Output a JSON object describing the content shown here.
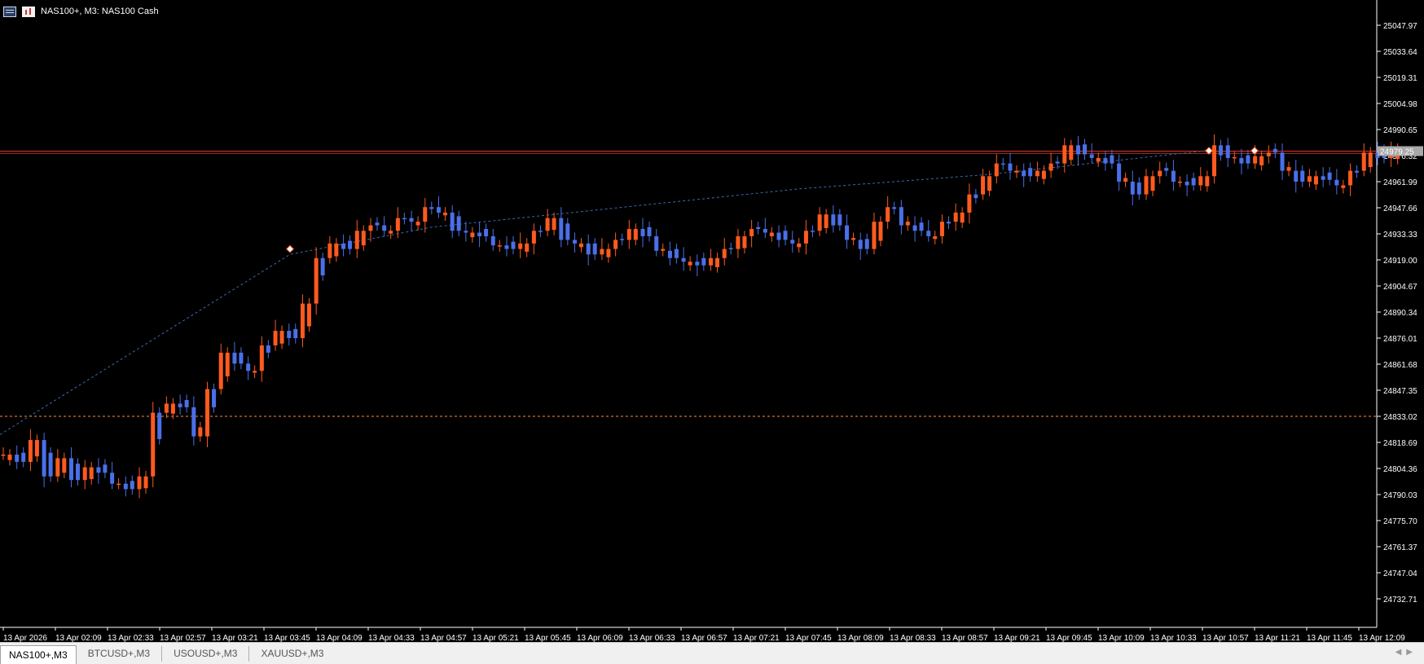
{
  "window": {
    "title": "NAS100+, M3:  NAS100 Cash"
  },
  "icons": [
    "menu-icon",
    "chart-type-icon"
  ],
  "colors": {
    "background": "#000000",
    "bull_candle": "#ff5a1f",
    "bear_candle": "#4a6fe8",
    "grid_axis": "#ffffff",
    "price_line": "#e0382a",
    "bid_label_bg": "#a9a9a9",
    "level_line": "#ff8c3a",
    "trend_line": "#3a6bb0"
  },
  "chart": {
    "current_price_label": "24979.25",
    "y_ticks": [
      "25047.97",
      "25033.64",
      "25019.31",
      "25004.98",
      "24990.65",
      "24976.32",
      "24961.99",
      "24947.66",
      "24933.33",
      "24919.00",
      "24904.67",
      "24890.34",
      "24876.01",
      "24861.68",
      "24847.35",
      "24833.02",
      "24818.69",
      "24804.36",
      "24790.03",
      "24775.70",
      "24761.37",
      "24747.04",
      "24732.71"
    ],
    "x_ticks": [
      "13 Apr 2026",
      "13 Apr 02:09",
      "13 Apr 02:33",
      "13 Apr 02:57",
      "13 Apr 03:21",
      "13 Apr 03:45",
      "13 Apr 04:09",
      "13 Apr 04:33",
      "13 Apr 04:57",
      "13 Apr 05:21",
      "13 Apr 05:45",
      "13 Apr 06:09",
      "13 Apr 06:33",
      "13 Apr 06:57",
      "13 Apr 07:21",
      "13 Apr 07:45",
      "13 Apr 08:09",
      "13 Apr 08:33",
      "13 Apr 08:57",
      "13 Apr 09:21",
      "13 Apr 09:45",
      "13 Apr 10:09",
      "13 Apr 10:33",
      "13 Apr 10:57",
      "13 Apr 11:21",
      "13 Apr 11:45",
      "13 Apr 12:09"
    ],
    "horizontal_levels": [
      24978.8,
      24833.0
    ],
    "close_path": [
      24812,
      24808,
      24820,
      24800,
      24810,
      24798,
      24805,
      24802,
      24796,
      24793,
      24800,
      24835,
      24840,
      24838,
      24822,
      24848,
      24868,
      24862,
      24858,
      24872,
      24880,
      24876,
      24895,
      24920,
      24928,
      24925,
      24935,
      24938,
      24935,
      24942,
      24940,
      24948,
      24945,
      24935,
      24934,
      24932,
      24927,
      24925,
      24928,
      24935,
      24942,
      24930,
      24928,
      24922,
      24925,
      24930,
      24936,
      24932,
      24924,
      24920,
      24918,
      24916,
      24920,
      24925,
      24932,
      24936,
      24934,
      24930,
      24928,
      24935,
      24944,
      24938,
      24930,
      24925,
      24940,
      24948,
      24938,
      24935,
      24932,
      24940,
      24945,
      24955,
      24965,
      24972,
      24968,
      24965,
      24968,
      24972,
      24982,
      24977,
      24975,
      24972,
      24962,
      24955,
      24965,
      24968,
      24962,
      24960,
      24965,
      24982,
      24975,
      24972,
      24976,
      24978,
      24968,
      24962,
      24965,
      24963,
      24960,
      24968,
      24978,
      24975,
      24980
    ]
  },
  "tabs": [
    {
      "label": "NAS100+,M3",
      "active": true
    },
    {
      "label": "BTCUSD+,M3",
      "active": false
    },
    {
      "label": "USOUSD+,M3",
      "active": false
    },
    {
      "label": "XAUUSD+,M3",
      "active": false
    }
  ]
}
